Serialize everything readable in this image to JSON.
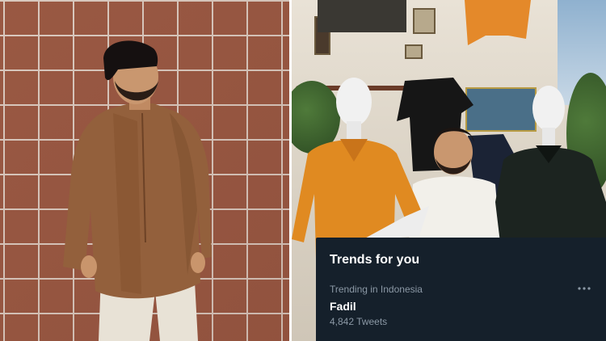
{
  "trends_panel": {
    "title": "Trends for you",
    "trends": [
      {
        "context": "Trending in Indonesia",
        "name": "Fadil",
        "tweet_count": "4,842 Tweets",
        "more_icon": "more-horizontal-icon"
      }
    ]
  },
  "colors": {
    "panel_background": "#15202b",
    "primary_text": "#ffffff",
    "secondary_text": "#8b98a5"
  }
}
